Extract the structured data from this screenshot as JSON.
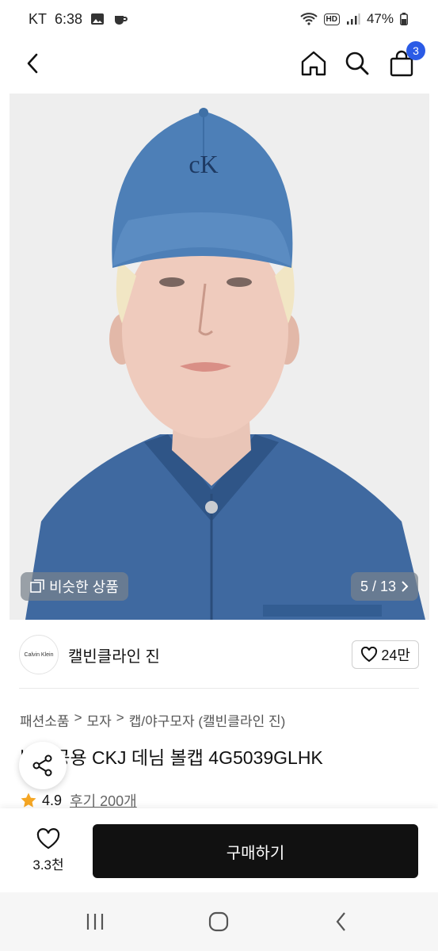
{
  "status_bar": {
    "carrier": "KT",
    "time": "6:38",
    "hd": "HD",
    "battery": "47%"
  },
  "nav": {
    "cart_count": "3"
  },
  "image": {
    "similar_label": "비슷한 상품",
    "counter": "5 / 13",
    "cap_logo": "cK"
  },
  "brand": {
    "logo_text": "Calvin Klein",
    "name": "캘빈클라인 진",
    "likes": "24만"
  },
  "breadcrumb": [
    "패션소품",
    ">",
    "모자",
    ">",
    "캡/야구모자 (캘빈클라인 진)"
  ],
  "product": {
    "title": "남녀공용 CKJ 데님 볼캡 4G5039GLHK",
    "rating": "4.9",
    "reviews": "후기 200개"
  },
  "action_bar": {
    "wish_count": "3.3천",
    "buy_label": "구매하기"
  },
  "colors": {
    "accent": "#2b5be6",
    "star": "#f5a623",
    "denim": "#4a74a8"
  }
}
